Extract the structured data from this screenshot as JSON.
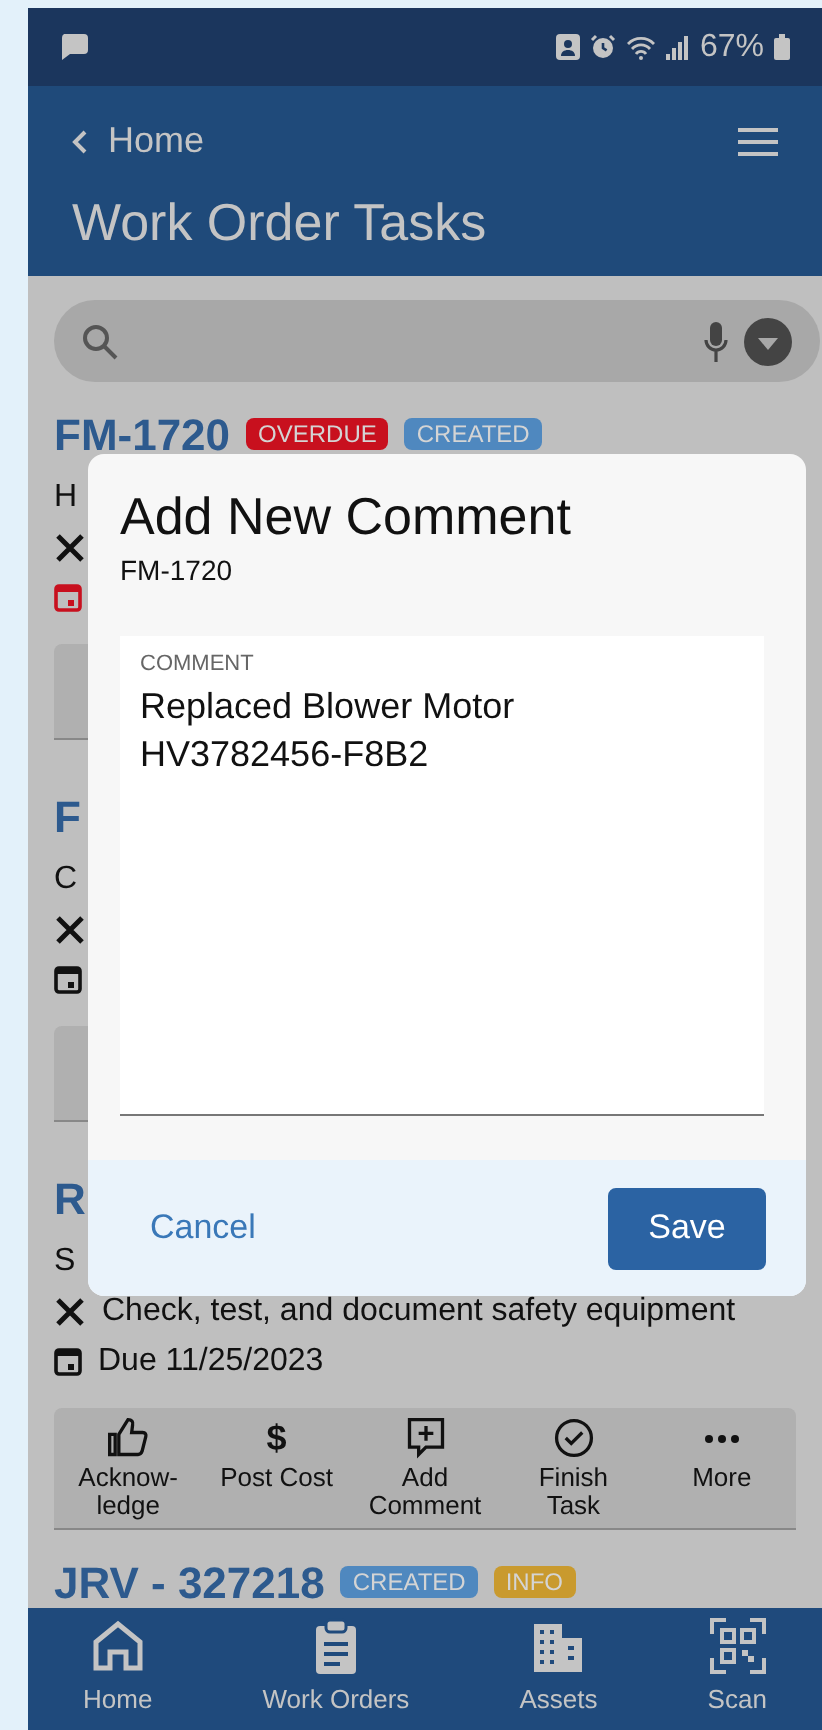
{
  "status_bar": {
    "battery": "67%"
  },
  "header": {
    "back_label": "Home",
    "title": "Work Order Tasks"
  },
  "cards": [
    {
      "kind": "full",
      "id": "FM-1720",
      "overdue": true,
      "description": "H",
      "badges": [
        {
          "label": "OVERDUE",
          "color": "#c8101e"
        },
        {
          "label": "CREATED",
          "color": "#4f88bf"
        }
      ]
    },
    {
      "kind": "full",
      "id": "F",
      "overdue": false,
      "description": "C"
    },
    {
      "kind": "full",
      "id": "R",
      "overdue": false,
      "description": "S",
      "task": "Check, test, and document safety equipment",
      "due": "Due 11/25/2023",
      "actions": [
        {
          "kind": "thumb",
          "label": "Acknow-ledge"
        },
        {
          "kind": "text",
          "symbol": "$",
          "label": "Post Cost"
        },
        {
          "kind": "comment",
          "label": "Add Comment"
        },
        {
          "kind": "check",
          "label": "Finish Task"
        },
        {
          "kind": "dots",
          "label": "More"
        }
      ]
    },
    {
      "kind": "header_only",
      "id": "JRV - 327218",
      "badges": [
        {
          "label": "CREATED",
          "color": "#4f88bf"
        },
        {
          "label": "INFO",
          "color": "#c99a2e"
        }
      ]
    }
  ],
  "dialog": {
    "title": "Add New Comment",
    "subtitle": "FM-1720",
    "field_label": "COMMENT",
    "value": "Replaced Blower Motor HV3782456-F8B2",
    "cancel": "Cancel",
    "save": "Save"
  },
  "bottom_nav": [
    {
      "kind": "home",
      "label": "Home"
    },
    {
      "kind": "clipboard",
      "label": "Work Orders"
    },
    {
      "kind": "building",
      "label": "Assets"
    },
    {
      "kind": "qr",
      "label": "Scan"
    }
  ]
}
